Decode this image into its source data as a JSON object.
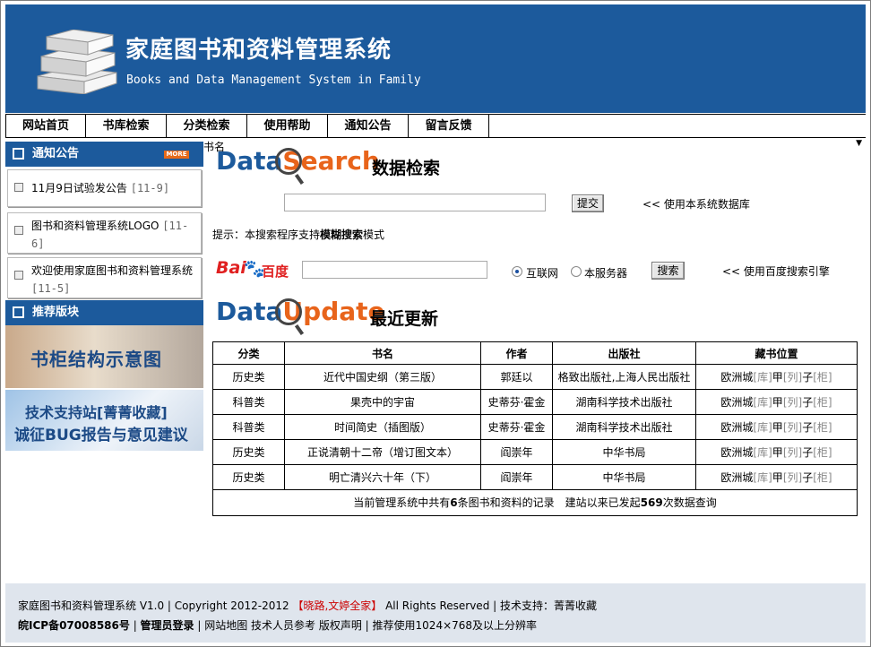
{
  "header": {
    "title": "家庭图书和资料管理系统",
    "subtitle": "Books and Data Management System in Family"
  },
  "nav": [
    "网站首页",
    "书库检索",
    "分类检索",
    "使用帮助",
    "通知公告",
    "留言反馈"
  ],
  "sidebar": {
    "notice_title": "通知公告",
    "more": "MORE",
    "notices": [
      {
        "text": "11月9日试验发公告",
        "date": "[11-9]"
      },
      {
        "text": "图书和资料管理系统LOGO",
        "date": "[11-6]"
      },
      {
        "text": "欢迎使用家庭图书和资料管理系统",
        "date": "[11-5]"
      }
    ],
    "recommend_title": "推荐版块",
    "banner1": "书柜结构示意图",
    "banner2_line1": "技术支持站[菁菁收藏]",
    "banner2_line2": "诚征BUG报告与意见建议"
  },
  "search": {
    "title_a": "Data",
    "title_b": "Search",
    "title_cn": "数据检索",
    "field_select": "书名",
    "submit": "提交",
    "local_link": "<< 使用本系统数据库",
    "tip_pre": "提示：本搜索程序支持",
    "tip_bold": "模糊搜索",
    "tip_post": "模式",
    "baidu_bai": "Bai",
    "baidu_paw": "🐾",
    "baidu_cn": "百度",
    "radio_internet": "互联网",
    "radio_server": "本服务器",
    "baidu_btn": "搜索",
    "baidu_link": "<< 使用百度搜索引擎"
  },
  "update": {
    "title_a": "Data",
    "title_b": "Update",
    "title_cn": "最近更新",
    "headers": [
      "分类",
      "书名",
      "作者",
      "出版社",
      "藏书位置"
    ],
    "rows": [
      {
        "cat": "历史类",
        "name": "近代中国史纲（第三版）",
        "author": "郭廷以",
        "press": "格致出版社,上海人民出版社",
        "loc": [
          "欧洲城",
          "[库]",
          "甲",
          "[列]",
          "子",
          "[柜]"
        ]
      },
      {
        "cat": "科普类",
        "name": "果壳中的宇宙",
        "author": "史蒂芬·霍金",
        "press": "湖南科学技术出版社",
        "loc": [
          "欧洲城",
          "[库]",
          "甲",
          "[列]",
          "子",
          "[柜]"
        ]
      },
      {
        "cat": "科普类",
        "name": "时间简史（插图版）",
        "author": "史蒂芬·霍金",
        "press": "湖南科学技术出版社",
        "loc": [
          "欧洲城",
          "[库]",
          "甲",
          "[列]",
          "子",
          "[柜]"
        ]
      },
      {
        "cat": "历史类",
        "name": "正说清朝十二帝（增订图文本）",
        "author": "阎崇年",
        "press": "中华书局",
        "loc": [
          "欧洲城",
          "[库]",
          "甲",
          "[列]",
          "子",
          "[柜]"
        ]
      },
      {
        "cat": "历史类",
        "name": "明亡清兴六十年（下）",
        "author": "阎崇年",
        "press": "中华书局",
        "loc": [
          "欧洲城",
          "[库]",
          "甲",
          "[列]",
          "子",
          "[柜]"
        ]
      }
    ],
    "summary_pre": "当前管理系统中共有",
    "summary_count": "6",
    "summary_mid": "条图书和资料的记录　建站以来已发起",
    "summary_queries": "569",
    "summary_post": "次数据查询"
  },
  "footer": {
    "line1_a": "家庭图书和资料管理系统 V1.0 | Copyright 2012-2012 ",
    "line1_red": "【晓路,文婷全家】",
    "line1_b": " All Rights Reserved | 技术支持：菁菁收藏",
    "icp": "皖ICP备07008586号",
    "admin": "管理员登录",
    "line2_rest": " | 网站地图 技术人员参考 版权声明 | 推荐使用1024×768及以上分辨率"
  }
}
